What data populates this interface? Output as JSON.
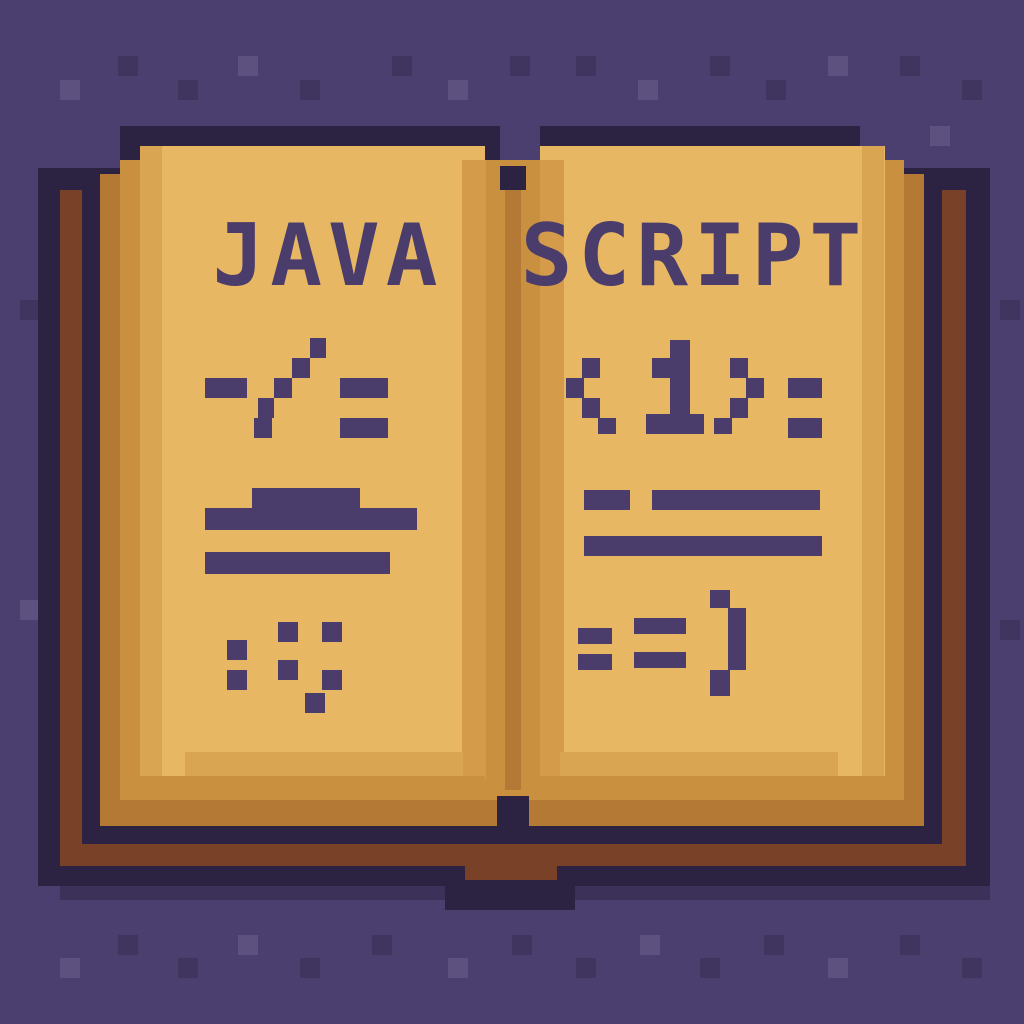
{
  "book": {
    "left_page_title": "JAVA",
    "right_page_title": "SCRIPT",
    "right_page_glyph": "<1>"
  },
  "icons": {
    "book": "open-book-icon",
    "left_symbols": "slash-equals-icon",
    "right_symbols": "angle-brackets-icon"
  },
  "colors": {
    "background": "#4a3f6e",
    "background_speckle": "#5d517f",
    "page": "#e8b764",
    "page_shadow": "#c8903f",
    "page_edge": "#b47a35",
    "cover": "#7a4129",
    "outline": "#2c2241",
    "ink": "#4a3c6b"
  }
}
